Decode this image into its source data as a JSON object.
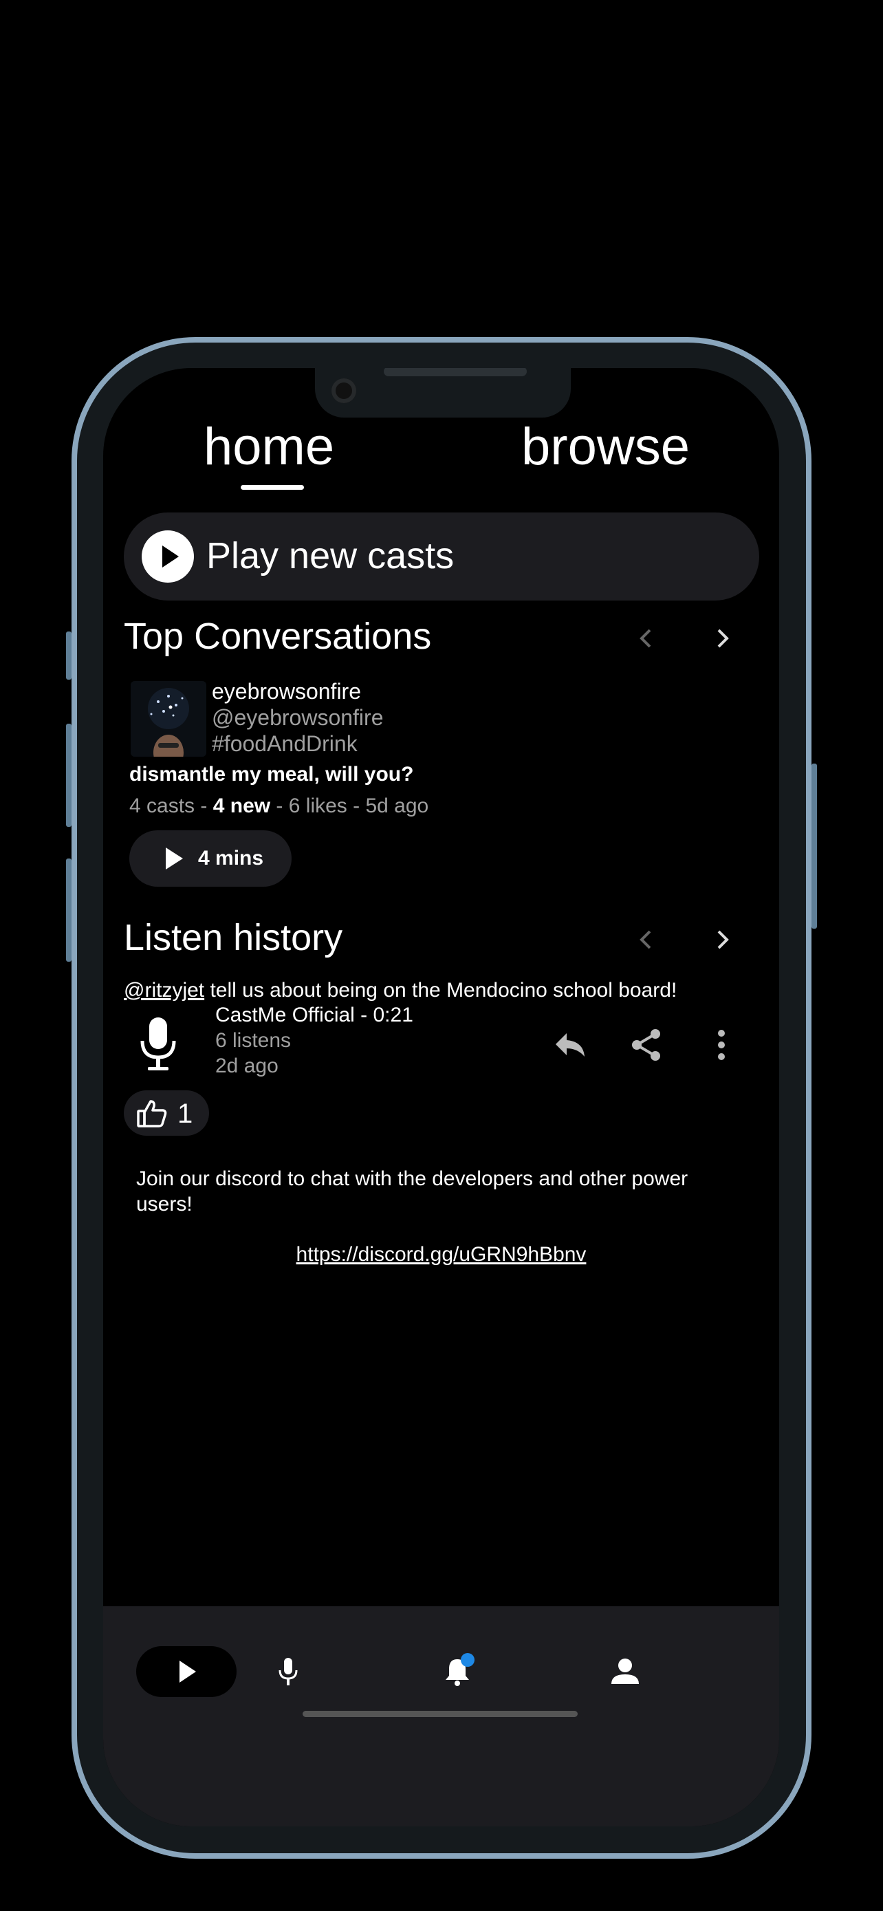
{
  "tabs": {
    "home": "home",
    "browse": "browse"
  },
  "play_new": {
    "label": "Play new casts"
  },
  "top_conversations": {
    "title": "Top Conversations",
    "card": {
      "name": "eyebrowsonfire",
      "handle": "@eyebrowsonfire",
      "tag": "#foodAndDrink",
      "title": "dismantle my meal, will you?",
      "meta_casts": "4 casts",
      "meta_sep1": " - ",
      "meta_new": "4 new",
      "meta_rest": " - 6 likes - 5d ago",
      "duration": "4 mins"
    }
  },
  "listen_history": {
    "title": "Listen history",
    "item": {
      "mention": "@ritzyjet",
      "text": " tell us about being on the Mendocino school board!",
      "author": "CastMe Official - 0:21",
      "listens": "6 listens",
      "age": "2d ago",
      "likes": "1"
    }
  },
  "discord": {
    "text": "Join our discord to chat with the developers and other power users!",
    "link": "https://discord.gg/uGRN9hBbnv"
  },
  "bottom_nav": [
    "play",
    "record",
    "notifications",
    "profile"
  ],
  "colors": {
    "background": "#000000",
    "pill": "#1c1c20",
    "accent_badge": "#1e88e5",
    "muted_text": "#a0a0a0"
  }
}
